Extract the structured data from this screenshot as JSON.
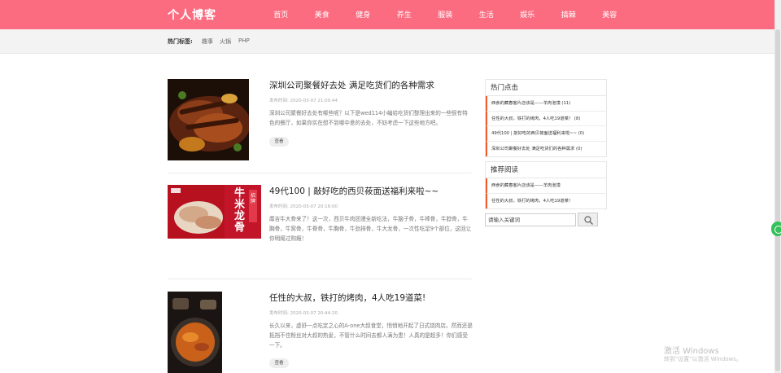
{
  "header": {
    "logo": "个人博客",
    "nav": [
      "首页",
      "美食",
      "健身",
      "养生",
      "服装",
      "生活",
      "娱乐",
      "搞棘",
      "美容"
    ]
  },
  "tags": {
    "label": "热门标签:",
    "items": [
      "趣事",
      "火锅",
      "PHP"
    ]
  },
  "posts": [
    {
      "title": "深圳公司聚餐好去处 满足吃货们的各种需求",
      "date": "发布时间: 2020-03-07 21:00:44",
      "excerpt": "深圳公司聚餐好去处有哪些呢？以下是wed114小编给吃货们整理出来的一些很有特色的餐厅，如果你实在想不到哪中意的去处，不妨考虑一下这些地方吧。",
      "button": "查看"
    },
    {
      "title": "49代100 | 敲好吃的西贝莜面送福利来啦~~",
      "date": "发布时间: 2020-03-07 20:16:00",
      "excerpt": "靡吉牛大骨来了！这一次，西贝牛肉团漫全新吃法，牛脑子骨，牛棒骨，牛脖骨，牛胸骨，牛窝骨，牛脊骨，牛胸骨，牛劲排骨，牛大龙骨，一次性吃足9个部位，这回让你明阁过购瘾！",
      "thumb_label": "牛米龙骨",
      "thumb_sublabel": "招牌",
      "button": ""
    },
    {
      "title": "任性的大叔，铁打的烤肉，4人吃19道菜!",
      "date": "发布时间: 2020-03-07 20:44:20",
      "excerpt": "长久以来，虚舒一点吃定之心的A-one大叔食堂，悄悄地开起了日式烧肉店。然而还是抵挡不住粉丝对大叔的热爱，不管什么时间去都人满为患！人真的是超多！你们感受一下。",
      "button": "查看"
    }
  ],
  "sidebar": {
    "hot": {
      "title": "热门点击",
      "items": [
        "西食的藏春客片店该是——羊肉泡馍 (11)",
        "任性的大叔，铁打的烤肉，4人吃19道菜！ (8)",
        "49代100 | 敲好吃的西贝莜面送福利来啦~~ (0)",
        "深圳公司聚餐好去处 满足吃货们的各种需求 (0)"
      ]
    },
    "recommend": {
      "title": "推荐阅读",
      "items": [
        "西食的藏春客片店该是——羊肉泡馍",
        "任性的大叔，铁打的烤肉，4人吃19道菜！"
      ]
    },
    "search_placeholder": "请输入关键词"
  },
  "watermark": {
    "line1": "激活 Windows",
    "line2": "转到\"设置\"以激活 Windows。"
  },
  "colors": {
    "header": "#fc6c80",
    "accent": "#f05a2a"
  }
}
